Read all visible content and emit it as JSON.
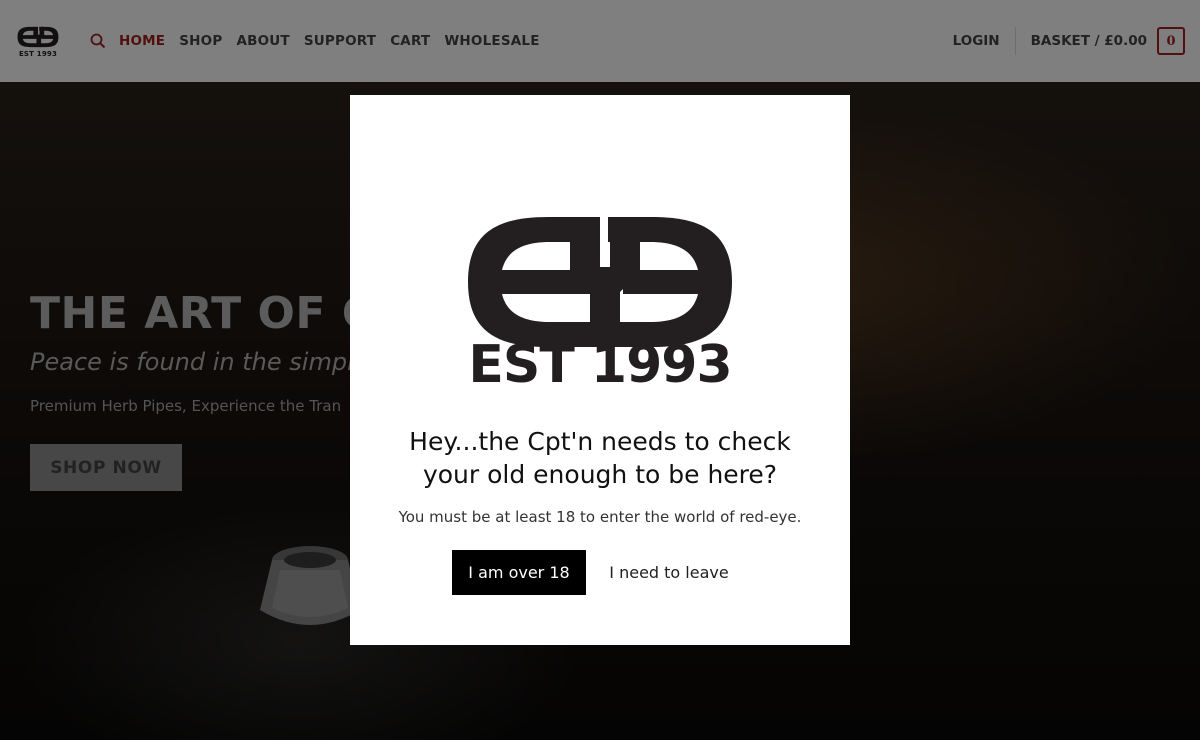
{
  "header": {
    "logo_est": "EST 1993",
    "search_icon": "search-icon",
    "nav": [
      {
        "label": "HOME",
        "active": true
      },
      {
        "label": "SHOP",
        "active": false
      },
      {
        "label": "ABOUT",
        "active": false
      },
      {
        "label": "SUPPORT",
        "active": false
      },
      {
        "label": "CART",
        "active": false
      },
      {
        "label": "WHOLESALE",
        "active": false
      }
    ],
    "login": "LOGIN",
    "basket": "BASKET / £0.00",
    "cart_count": "0"
  },
  "hero": {
    "title": "THE ART OF CA",
    "subtitle": "Peace is found in the simpl",
    "text": "Premium Herb Pipes, Experience the Tran",
    "button": "SHOP NOW"
  },
  "modal": {
    "logo_est": "EST 1993",
    "heading_line1": "Hey...the Cpt'n needs to check",
    "heading_line2": "your old enough to be here?",
    "text": "You must be at least 18 to enter the world of red-eye.",
    "confirm_button": "I am over 18",
    "leave_button": "I need to leave"
  },
  "colors": {
    "accent": "#a51e1e",
    "logo": "#231f20",
    "button_dark": "#000000"
  }
}
